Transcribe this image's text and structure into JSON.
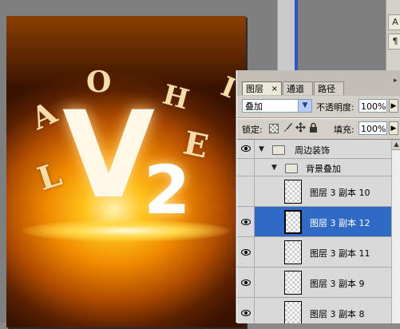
{
  "canvas": {
    "letters": [
      "A",
      "O",
      "H",
      "I",
      "L",
      "E"
    ],
    "big_v": "V",
    "big_2": "2"
  },
  "side_toolbar": {
    "btn1": "A",
    "btn2": "¶"
  },
  "panel": {
    "tabs": [
      {
        "label": "图层",
        "active": true
      },
      {
        "label": "通道",
        "active": false
      },
      {
        "label": "路径",
        "active": false
      }
    ],
    "tab_close": "×",
    "menu_icon": "▸",
    "blend_mode": "叠加",
    "opacity_label": "不透明度:",
    "opacity_value": "100%",
    "lock_label": "锁定:",
    "fill_label": "填充:",
    "fill_value": "100%",
    "arrow": "▶",
    "dropdown_arrow": "▼",
    "layers": [
      {
        "name": "周边装饰",
        "type": "group",
        "expanded": true,
        "visible": true,
        "selected": false
      },
      {
        "name": "背景叠加",
        "type": "group",
        "expanded": true,
        "visible": false,
        "selected": false
      },
      {
        "name": "图层 3 副本 10",
        "type": "layer",
        "visible": false,
        "selected": false
      },
      {
        "name": "图层 3 副本 12",
        "type": "layer",
        "visible": true,
        "selected": true
      },
      {
        "name": "图层 3 副本 11",
        "type": "layer",
        "visible": true,
        "selected": false
      },
      {
        "name": "图层 3 副本 9",
        "type": "layer",
        "visible": true,
        "selected": false
      },
      {
        "name": "图层 3 副本 8",
        "type": "layer",
        "visible": true,
        "selected": false
      }
    ]
  },
  "colors": {
    "selected_row": "#316ac5",
    "panel_bg": "#d4d0c8"
  }
}
